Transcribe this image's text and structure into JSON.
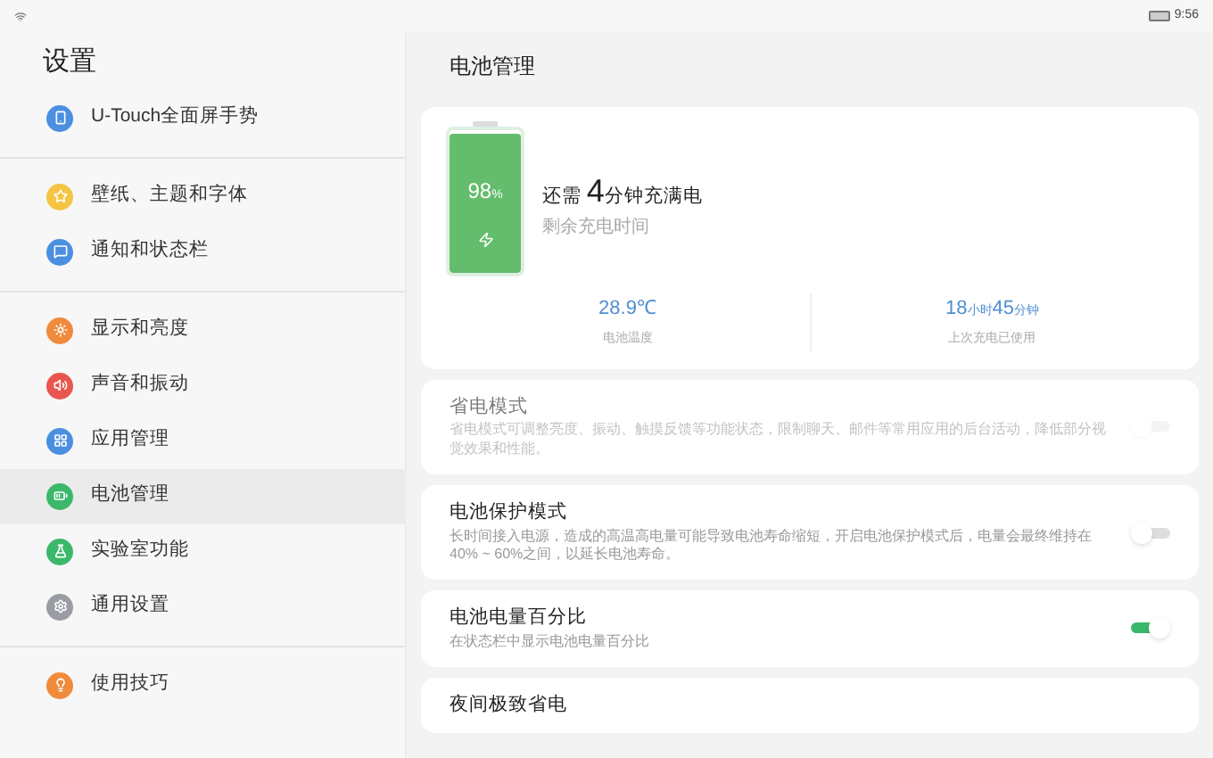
{
  "status_bar": {
    "time": "9:56"
  },
  "sidebar": {
    "title": "设置",
    "groups": [
      {
        "items": [
          {
            "label": "U-Touch全面屏手势",
            "color": "#4a8fe0",
            "selected": false
          }
        ]
      },
      {
        "items": [
          {
            "label": "壁纸、主题和字体",
            "color": "#f5c443",
            "selected": false
          },
          {
            "label": "通知和状态栏",
            "color": "#4a8fe0",
            "selected": false
          }
        ]
      },
      {
        "items": [
          {
            "label": "显示和亮度",
            "color": "#f08a3c",
            "selected": false
          },
          {
            "label": "声音和振动",
            "color": "#e8564f",
            "selected": false
          },
          {
            "label": "应用管理",
            "color": "#4a8fe0",
            "selected": false
          },
          {
            "label": "电池管理",
            "color": "#3cb86a",
            "selected": true
          },
          {
            "label": "实验室功能",
            "color": "#3cb86a",
            "selected": false
          },
          {
            "label": "通用设置",
            "color": "#9a9ca3",
            "selected": false
          }
        ]
      },
      {
        "items": [
          {
            "label": "使用技巧",
            "color": "#f08a3c",
            "selected": false
          }
        ]
      }
    ]
  },
  "page": {
    "title": "电池管理",
    "battery": {
      "level": 0.98,
      "percent": "98",
      "percent_unit": "%",
      "charging": true,
      "prefix": "还需",
      "minutes": "4",
      "suffix": "分钟充满电",
      "caption": "剩余充电时间",
      "stats": [
        {
          "parts": [
            {
              "value": "28.9℃"
            }
          ],
          "label": "电池温度"
        },
        {
          "parts": [
            {
              "value": "18",
              "unit": "小时"
            },
            {
              "value": "45",
              "unit": "分钟"
            }
          ],
          "label": "上次充电已使用"
        }
      ]
    },
    "settings": [
      {
        "title": "省电模式",
        "description": "省电模式可调整亮度、振动、触摸反馈等功能状态，限制聊天、邮件等常用应用的后台活动，降低部分视觉效果和性能。",
        "on": false,
        "disabled": true
      },
      {
        "title": "电池保护模式",
        "description": "长时间接入电源，造成的高温高电量可能导致电池寿命缩短，开启电池保护模式后，电量会最终维持在40% ~ 60%之间，以延长电池寿命。",
        "on": false,
        "disabled": false
      },
      {
        "title": "电池电量百分比",
        "description": "在状态栏中显示电池电量百分比",
        "on": true,
        "disabled": false
      },
      {
        "title": "夜间极致省电",
        "disabled": false
      }
    ]
  }
}
